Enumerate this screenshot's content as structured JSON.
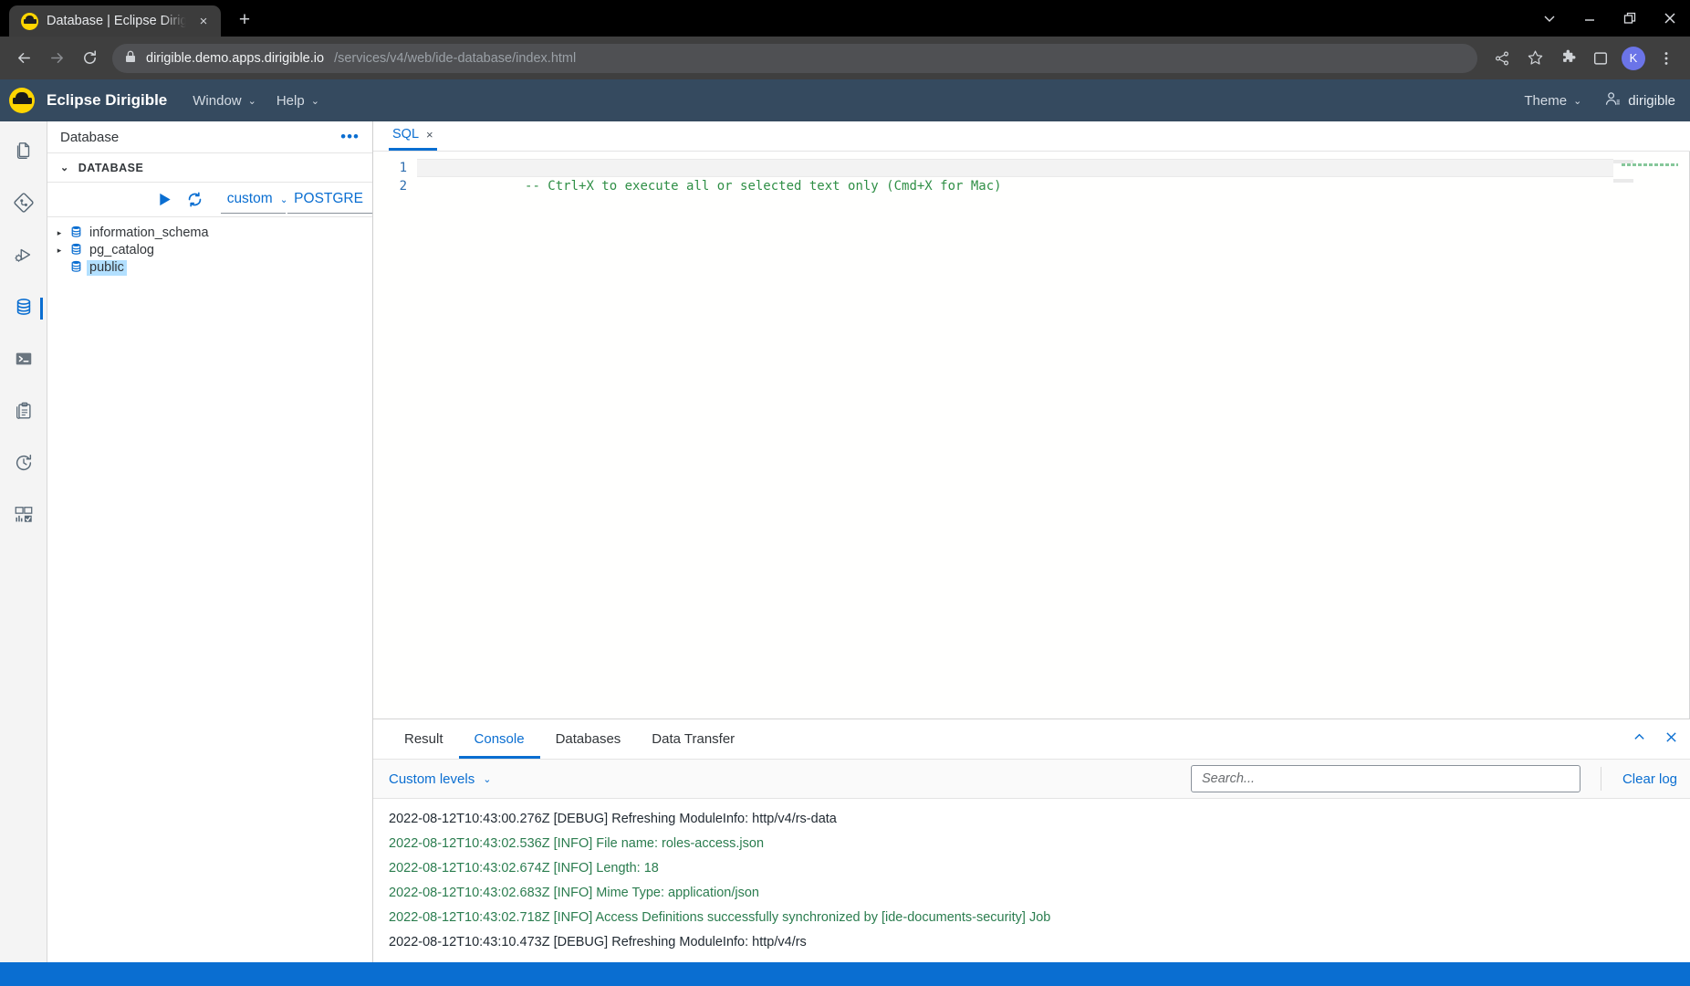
{
  "browser": {
    "tab": {
      "title": "Database | Eclipse Dirigible",
      "close": "×",
      "favicon": "dirigible-logo-icon"
    },
    "newtab_label": "+",
    "window_controls": {
      "more": "⌄",
      "minimize": "—",
      "maximize": "❐",
      "close": "×"
    },
    "nav": {
      "back": "←",
      "forward": "→",
      "reload": "↻"
    },
    "omnibox": {
      "lock": "🔒",
      "url_host": "dirigible.demo.apps.dirigible.io",
      "url_path": "/services/v4/web/ide-database/index.html"
    },
    "actions": {
      "share": "share-icon",
      "bookmark": "☆",
      "extensions": "puzzle-icon",
      "sidepanel": "□",
      "profile_initial": "K",
      "menu": "⋮"
    }
  },
  "app_header": {
    "brand": "Eclipse Dirigible",
    "menus": [
      {
        "label": "Window",
        "caret": "⌄"
      },
      {
        "label": "Help",
        "caret": "⌄"
      }
    ],
    "theme": {
      "label": "Theme",
      "caret": "⌄"
    },
    "user": "dirigible"
  },
  "rail": {
    "items": [
      {
        "name": "workspace-icon",
        "active": false
      },
      {
        "name": "git-icon",
        "active": false
      },
      {
        "name": "debugger-icon",
        "active": false
      },
      {
        "name": "database-icon",
        "active": true
      },
      {
        "name": "terminal-icon",
        "active": false
      },
      {
        "name": "clipboard-icon",
        "active": false
      },
      {
        "name": "history-icon",
        "active": false
      },
      {
        "name": "dashboard-icon",
        "active": false
      }
    ]
  },
  "explorer": {
    "title": "Database",
    "more": "•••",
    "section": {
      "label": "DATABASE",
      "twisty": "⌄"
    },
    "toolbar": {
      "run": "▶",
      "refresh": "⟳"
    },
    "datasource_select": {
      "value": "custom",
      "caret": "⌄"
    },
    "dbtype_select": {
      "value": "POSTGRE",
      "caret": "⌄"
    },
    "tree": [
      {
        "label": "information_schema",
        "expandable": true,
        "selected": false,
        "arrow": "▸"
      },
      {
        "label": "pg_catalog",
        "expandable": true,
        "selected": false,
        "arrow": "▸"
      },
      {
        "label": "public",
        "expandable": false,
        "selected": true,
        "arrow": ""
      }
    ]
  },
  "editor": {
    "tab": {
      "label": "SQL",
      "close": "×"
    },
    "lines": [
      {
        "number": "1",
        "text": "-- Ctrl+X to execute all or selected text only (Cmd+X for Mac)",
        "active": true
      },
      {
        "number": "2",
        "text": "",
        "active": false
      }
    ]
  },
  "console": {
    "tabs": [
      {
        "label": "Result",
        "active": false
      },
      {
        "label": "Console",
        "active": true
      },
      {
        "label": "Databases",
        "active": false
      },
      {
        "label": "Data Transfer",
        "active": false
      }
    ],
    "panel_actions": {
      "collapse": "⌃",
      "close": "×"
    },
    "levels": {
      "label": "Custom levels",
      "caret": "⌄"
    },
    "search": {
      "value": "",
      "placeholder": "Search..."
    },
    "clear_log": "Clear log",
    "logs": [
      {
        "level": "debug",
        "text": "2022-08-12T10:43:00.276Z [DEBUG] Refreshing ModuleInfo: http/v4/rs-data"
      },
      {
        "level": "info",
        "text": "2022-08-12T10:43:02.536Z [INFO] File name: roles-access.json"
      },
      {
        "level": "info",
        "text": "2022-08-12T10:43:02.674Z [INFO] Length: 18"
      },
      {
        "level": "info",
        "text": "2022-08-12T10:43:02.683Z [INFO] Mime Type: application/json"
      },
      {
        "level": "info",
        "text": "2022-08-12T10:43:02.718Z [INFO] Access Definitions successfully synchronized by [ide-documents-security] Job"
      },
      {
        "level": "debug",
        "text": "2022-08-12T10:43:10.473Z [DEBUG] Refreshing ModuleInfo: http/v4/rs"
      }
    ]
  },
  "colors": {
    "accent": "#0a6ed1",
    "header_bg": "#354a5f",
    "brand_yellow": "#ffd500",
    "info_green": "#2b7d4f",
    "status_bar": "#0a6ed1"
  }
}
